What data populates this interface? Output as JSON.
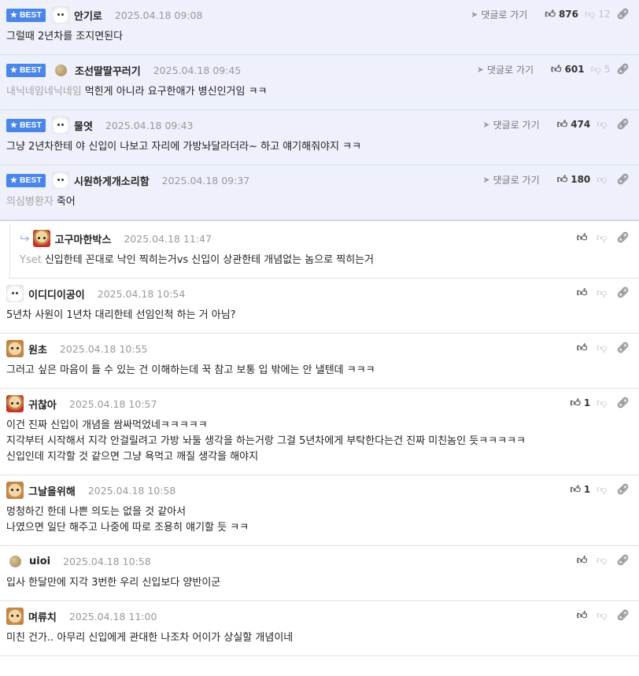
{
  "ui": {
    "best_label": "BEST",
    "reply_to_label": "댓글로 가기"
  },
  "best_comments": [
    {
      "avatar": "white",
      "nick": "안기로",
      "date": "2025.04.18 09:08",
      "up": "876",
      "down": "12",
      "mention": "",
      "lines": [
        "그럴때 2년차를 조지면된다"
      ]
    },
    {
      "avatar": "dot",
      "nick": "조선딸딸꾸러기",
      "date": "2025.04.18 09:45",
      "up": "601",
      "down": "5",
      "mention": "내닉네임네닉네임",
      "lines": [
        "먹힌게 아니라 요구한애가 병신인거임 ㅋㅋ"
      ]
    },
    {
      "avatar": "white",
      "nick": "물엿",
      "date": "2025.04.18 09:43",
      "up": "474",
      "down": "",
      "mention": "",
      "lines": [
        "그냥 2년차한테 야 신입이 나보고 자리에 가방놔달라더라~ 하고 얘기해줘야지 ㅋㅋ"
      ]
    },
    {
      "avatar": "white",
      "nick": "시원하게개소리함",
      "date": "2025.04.18 09:37",
      "up": "180",
      "down": "",
      "mention": "의심병환자",
      "lines": [
        "죽어"
      ]
    }
  ],
  "comments": [
    {
      "reply": true,
      "avatar": "puppy-red",
      "nick": "고구마한박스",
      "date": "2025.04.18 11:47",
      "up": "",
      "mention": "Yset",
      "lines": [
        "신입한테 꼰대로 낙인 찍히는거vs 신입이 상관한테 개념없는 놈으로 찍히는거"
      ]
    },
    {
      "reply": false,
      "avatar": "white",
      "nick": "이디디이공이",
      "date": "2025.04.18 10:54",
      "up": "",
      "mention": "",
      "lines": [
        "5년차 사원이 1년차 대리한테 선임인척 하는 거 아님?"
      ]
    },
    {
      "reply": false,
      "avatar": "puppy",
      "nick": "원초",
      "date": "2025.04.18 10:55",
      "up": "",
      "mention": "",
      "lines": [
        "그러고 싶은 마음이 들 수 있는 건 이해하는데 꾹 참고 보통 입 밖에는 안 낼텐데 ㅋㅋㅋ"
      ]
    },
    {
      "reply": false,
      "avatar": "puppy-red",
      "nick": "귀찮아",
      "date": "2025.04.18 10:57",
      "up": "1",
      "mention": "",
      "lines": [
        "이건 진짜 신입이 개념을 쌈싸먹었네ㅋㅋㅋㅋㅋ",
        "지각부터 시작해서 지각 안걸릴려고 가방 놔둘 생각을 하는거랑 그걸 5년차에게 부탁한다는건 진짜 미친놈인 듯ㅋㅋㅋㅋㅋ",
        "신입인데 지각할 것 같으면 그냥 욕먹고 깨질 생각을 해야지"
      ]
    },
    {
      "reply": false,
      "avatar": "puppy",
      "nick": "그날을위해",
      "date": "2025.04.18 10:58",
      "up": "1",
      "mention": "",
      "lines": [
        "멍청하긴 한데 나쁜 의도는 없을 것 같아서",
        "나였으면 일단 해주고 나중에 따로 조용히 얘기할 듯 ㅋㅋ"
      ]
    },
    {
      "reply": false,
      "avatar": "dot",
      "nick": "uioi",
      "date": "2025.04.18 10:58",
      "up": "",
      "mention": "",
      "lines": [
        "입사 한달만에 지각 3번한 우리 신입보다 양반이군"
      ]
    },
    {
      "reply": false,
      "avatar": "puppy",
      "nick": "며류치",
      "date": "2025.04.18 11:00",
      "up": "",
      "mention": "",
      "lines": [
        "미친 건가.. 아무리 신입에게 관대한 나조차 어이가 상실할 개념이네"
      ]
    }
  ]
}
